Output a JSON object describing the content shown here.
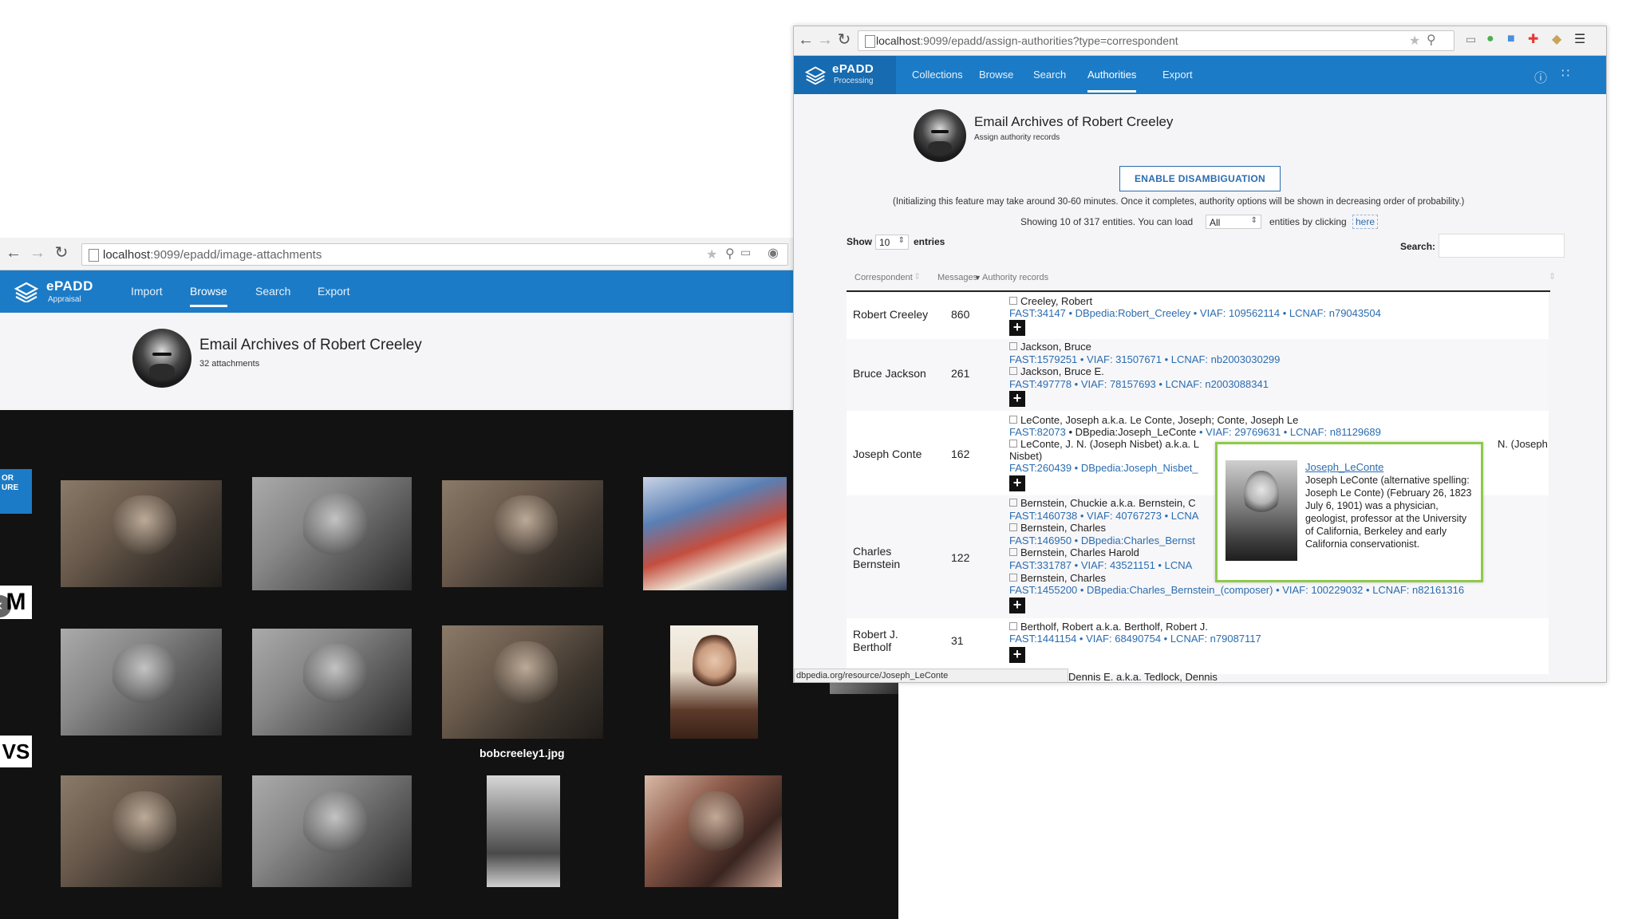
{
  "left_window": {
    "url_host": "localhost",
    "url_rest": ":9099/epadd/image-attachments",
    "brand": {
      "name": "ePADD",
      "sub": "Appraisal"
    },
    "nav": [
      "Import",
      "Browse",
      "Search",
      "Export"
    ],
    "active_nav": "Browse",
    "title": "Email Archives of Robert Creeley",
    "subtitle": "32 attachments",
    "caption": "bobcreeley1.jpg",
    "side_tab": "OR\nURE",
    "side_box_1": "M",
    "side_box_2": "VS",
    "nav_circle": "‹"
  },
  "right_window": {
    "url_host": "localhost",
    "url_rest": ":9099/epadd/assign-authorities?type=correspondent",
    "brand": {
      "name": "ePADD",
      "sub": "Processing"
    },
    "nav": [
      "Collections",
      "Browse",
      "Search",
      "Authorities",
      "Export"
    ],
    "active_nav": "Authorities",
    "title": "Email Archives of Robert Creeley",
    "subtitle": "Assign authority records",
    "disamb_button": "ENABLE DISAMBIGUATION",
    "init_note": "(Initializing this feature may take around 30-60 minutes. Once it completes, authority options will be shown in decreasing order of probability.)",
    "showing_prefix": "Showing 10 of 317 entities. You can load",
    "load_value": "All",
    "showing_suffix": "entities by clicking",
    "here_link": "here",
    "show_label": "Show",
    "entries_value": "10",
    "entries_label": "entries",
    "search_label": "Search:",
    "search_value": "",
    "columns": [
      "Correspondent",
      "Messages",
      "Authority records"
    ],
    "rows": [
      {
        "name": "Robert Creeley",
        "messages": "860",
        "records": [
          {
            "heading": "Creeley, Robert",
            "links": "FAST:34147 • DBpedia:Robert_Creeley • VIAF: 109562114 • LCNAF: n79043504"
          }
        ]
      },
      {
        "name": "Bruce Jackson",
        "messages": "261",
        "records": [
          {
            "heading": "Jackson, Bruce",
            "links": "FAST:1579251 • VIAF: 31507671 • LCNAF: nb2003030299"
          },
          {
            "heading": "Jackson, Bruce E.",
            "links": "FAST:497778 • VIAF: 78157693 • LCNAF: n2003088341"
          }
        ]
      },
      {
        "name": "Joseph Conte",
        "messages": "162",
        "records": [
          {
            "heading": "LeConte, Joseph a.k.a. Le Conte, Joseph; Conte, Joseph Le",
            "links_a": "FAST:82073",
            "links_dark": " • DBpedia:Joseph_LeConte",
            "links_b": " • VIAF: 29769631 • LCNAF: n81129689"
          },
          {
            "heading": "LeConte, J. N. (Joseph Nisbet) a.k.a. L",
            "heading_tail": "N. (Joseph",
            "heading_line2": "Nisbet)",
            "links": "FAST:260439 • DBpedia:Joseph_Nisbet_"
          }
        ]
      },
      {
        "name_line1": "Charles",
        "name_line2": "Bernstein",
        "messages": "122",
        "records": [
          {
            "heading": "Bernstein, Chuckie a.k.a. Bernstein, C",
            "links": "FAST:1460738 • VIAF: 40767273 • LCNA"
          },
          {
            "heading": "Bernstein, Charles",
            "links": "FAST:146950 • DBpedia:Charles_Bernst"
          },
          {
            "heading": "Bernstein, Charles Harold",
            "links": "FAST:331787 • VIAF: 43521151 • LCNA"
          },
          {
            "heading": "Bernstein, Charles",
            "links": "FAST:1455200 • DBpedia:Charles_Bernstein_(composer) • VIAF: 100229032 • LCNAF: n82161316"
          }
        ]
      },
      {
        "name_line1": "Robert J.",
        "name_line2": "Bertholf",
        "messages": "31",
        "records": [
          {
            "heading": "Bertholf, Robert a.k.a. Bertholf, Robert J.",
            "links": "FAST:1441154 • VIAF: 68490754 • LCNAF: n79087117"
          }
        ]
      }
    ],
    "next_row_partial": "Dennis E. a.k.a. Tedlock, Dennis",
    "popup": {
      "title": "Joseph_LeConte",
      "text": "Joseph LeConte (alternative spelling: Joseph Le Conte) (February 26, 1823 July 6, 1901) was a physician, geologist, professor at the University of California, Berkeley and early California conservationist."
    },
    "status_url": "dbpedia.org/resource/Joseph_LeConte"
  },
  "colors": {
    "nav_blue": "#1c7bc6",
    "link_blue": "#2b6cb0",
    "popup_border": "#8fc94a"
  }
}
